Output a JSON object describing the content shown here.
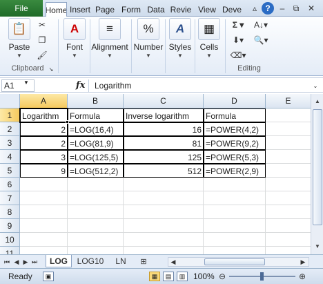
{
  "ribbon_tabs": {
    "file": "File",
    "home": "Home",
    "insert": "Insert",
    "page": "Page",
    "formulas": "Form",
    "data": "Data",
    "review": "Revie",
    "view": "View",
    "developer": "Deve"
  },
  "ribbon": {
    "clipboard": {
      "paste_label": "Paste",
      "group_label": "Clipboard"
    },
    "font_label": "Font",
    "alignment_label": "Alignment",
    "number_label": "Number",
    "styles_label": "Styles",
    "cells_label": "Cells",
    "editing_label": "Editing"
  },
  "formula_bar": {
    "name_box": "A1",
    "fx": "fx",
    "content": "Logarithm"
  },
  "grid": {
    "columns": [
      "A",
      "B",
      "C",
      "D",
      "E"
    ],
    "rows": [
      "1",
      "2",
      "3",
      "4",
      "5",
      "6",
      "7",
      "8",
      "9",
      "10",
      "11"
    ],
    "data": [
      [
        "Logarithm",
        "Formula",
        "Inverse logarithm",
        "Formula"
      ],
      [
        "2",
        "=LOG(16,4)",
        "16",
        "=POWER(4,2)"
      ],
      [
        "2",
        "=LOG(81,9)",
        "81",
        "=POWER(9,2)"
      ],
      [
        "3",
        "=LOG(125,5)",
        "125",
        "=POWER(5,3)"
      ],
      [
        "9",
        "=LOG(512,2)",
        "512",
        "=POWER(2,9)"
      ]
    ]
  },
  "sheets": [
    "LOG",
    "LOG10",
    "LN"
  ],
  "status": {
    "mode": "Ready",
    "zoom": "100%"
  }
}
